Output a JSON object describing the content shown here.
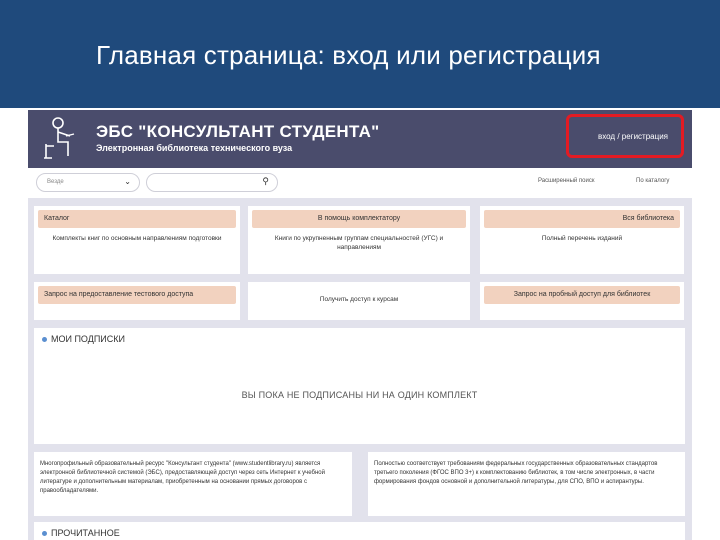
{
  "slide": {
    "title": "Главная страница: вход или регистрация"
  },
  "site": {
    "brand_title": "ЭБС \"КОНСУЛЬТАНТ СТУДЕНТА\"",
    "brand_subtitle": "Электронная библиотека технического вуза",
    "login_link": "вход / регистрация"
  },
  "search": {
    "select_value": "Везде",
    "input_value": "",
    "advanced_label": "Расширенный поиск",
    "advanced_label_2": "По каталогу"
  },
  "cards": [
    {
      "chip": "Каталог",
      "text": "Комплекты книг по основным направлениям подготовки"
    },
    {
      "chip": "В помощь комплектатору",
      "text": "Книги по укрупненным группам специальностей (УГС) и направлениям"
    },
    {
      "chip": "Вся библиотека",
      "text": "Полный перечень изданий"
    },
    {
      "chip": "Запрос на предоставление тестового доступа"
    },
    {
      "text": "Получить доступ к курсам"
    },
    {
      "chip": "Запрос на пробный доступ для библиотек"
    }
  ],
  "subscriptions": {
    "heading": "МОИ ПОДПИСКИ",
    "message": "ВЫ ПОКА НЕ ПОДПИСАНЫ НИ НА ОДИН КОМПЛЕКТ"
  },
  "info": {
    "left": "Многопрофильный образовательный ресурс \"Консультант студента\" (www.studentlibrary.ru) является электронной библиотечной системой (ЭБС), предоставляющей доступ через сеть Интернет к учебной литературе и дополнительным материалам, приобретенным на основании прямых договоров с правообладателями.",
    "right": "Полностью соответствует требованиям федеральных государственных образовательных стандартов третьего поколения (ФГОС ВПО 3+) к комплектованию библиотек, в том числе электронных, в части формирования фондов основной и дополнительной литературы, для СПО, ВПО и аспирантуры."
  },
  "read": {
    "heading": "ПРОЧИТАННОЕ"
  },
  "colors": {
    "header_bar": "#1f4a7c",
    "site_topbar": "#4a4c6c",
    "chip": "#f2d2bf",
    "highlight": "#e31b23"
  }
}
